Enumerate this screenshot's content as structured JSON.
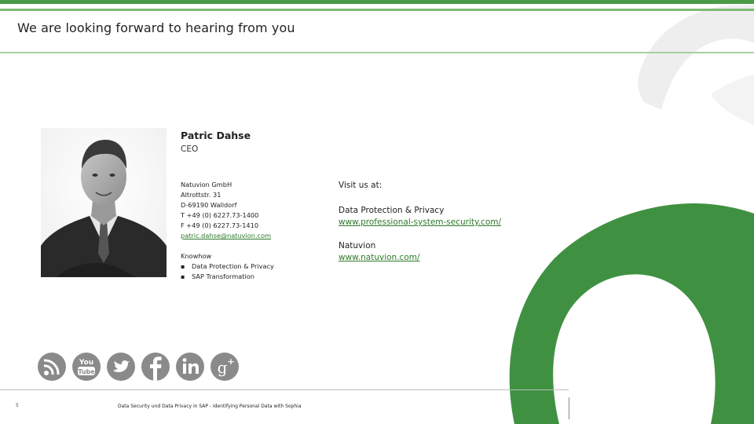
{
  "header": {
    "title": "We are looking forward to hearing from you"
  },
  "person": {
    "name": "Patric Dahse",
    "role": "CEO"
  },
  "contact": {
    "company": "Natuvion GmbH",
    "street": "Altrottstr. 31",
    "city": "D-69190 Walldorf",
    "phone": "T +49 (0) 6227.73-1400",
    "fax": "F +49 (0) 6227.73-1410",
    "email": "patric.dahse@natuvion.com"
  },
  "knowhow": {
    "label": "Knowhow",
    "items": [
      "Data Protection & Privacy",
      "SAP Transformation"
    ]
  },
  "visit": {
    "label": "Visit us at:",
    "sites": [
      {
        "name": "Data Protection & Privacy",
        "url": "www.professional-system-security.com/"
      },
      {
        "name": "Natuvion",
        "url": "www.natuvion.com/"
      }
    ]
  },
  "social_icons": [
    "rss-icon",
    "youtube-icon",
    "twitter-icon",
    "facebook-icon",
    "linkedin-icon",
    "google-plus-icon"
  ],
  "colors": {
    "accent_green": "#4a9a47",
    "link_green": "#2e7a2b",
    "brand_shape_green": "#3f9141"
  },
  "footer": {
    "page_number": "5",
    "text": "Data Security und Data Privacy in SAP - Identifying Personal Data with Sophia"
  }
}
